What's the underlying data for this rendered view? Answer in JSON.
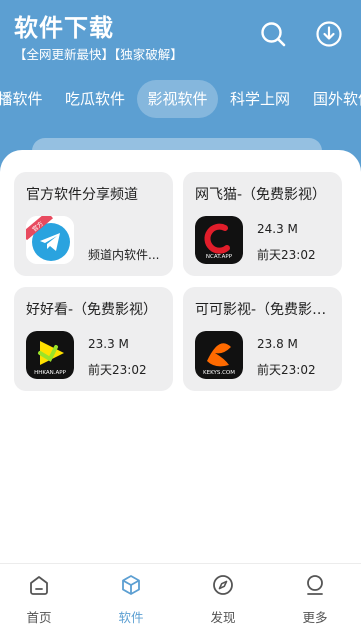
{
  "header": {
    "title": "软件下载",
    "subtitle": "【全网更新最快】【独家破解】"
  },
  "tabs": [
    {
      "label": "播软件",
      "active": false
    },
    {
      "label": "吃瓜软件",
      "active": false
    },
    {
      "label": "影视软件",
      "active": true
    },
    {
      "label": "科学上网",
      "active": false
    },
    {
      "label": "国外软件",
      "active": false
    }
  ],
  "apps": [
    {
      "title": "官方软件分享频道",
      "info": "频道内软件...",
      "icon": "telegram-icon",
      "badge": "官方"
    },
    {
      "title": "网飞猫-（免费影视）",
      "size": "24.3 M",
      "time": "前天23:02",
      "icon": "ncat-icon",
      "icon_text": "NCAT.APP"
    },
    {
      "title": "好好看-（免费影视）",
      "size": "23.3 M",
      "time": "前天23:02",
      "icon": "hhkan-icon",
      "icon_text": "HHKAN.APP"
    },
    {
      "title": "可可影视-（免费影视）",
      "size": "23.8 M",
      "time": "前天23:02",
      "icon": "keke-icon",
      "icon_text": "KEKYS.COM"
    }
  ],
  "nav": [
    {
      "label": "首页",
      "icon": "home-icon",
      "active": false
    },
    {
      "label": "软件",
      "icon": "box-icon",
      "active": true
    },
    {
      "label": "发现",
      "icon": "compass-icon",
      "active": false
    },
    {
      "label": "更多",
      "icon": "user-icon",
      "active": false
    }
  ],
  "colors": {
    "brand": "#5c9fd2",
    "card_bg": "#eeeeef"
  }
}
